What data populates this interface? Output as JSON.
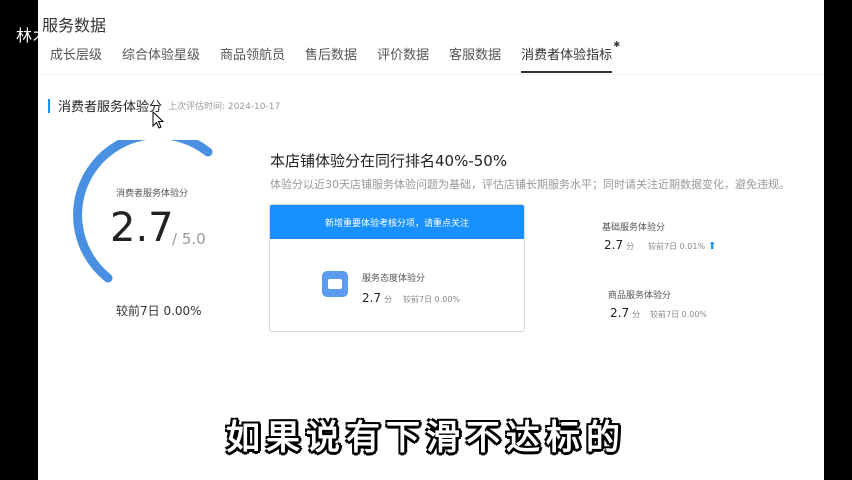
{
  "watermark": "林木",
  "page_title": "服务数据",
  "tabs": [
    {
      "label": "成长层级"
    },
    {
      "label": "综合体验星级"
    },
    {
      "label": "商品领航员"
    },
    {
      "label": "售后数据"
    },
    {
      "label": "评价数据"
    },
    {
      "label": "客服数据"
    },
    {
      "label": "消费者体验指标",
      "active": true
    }
  ],
  "section": {
    "title": "消费者服务体验分",
    "subtitle": "上次评估时间: 2024-10-17"
  },
  "gauge": {
    "label": "消费者服务体验分",
    "score": "2.7",
    "max": "/ 5.0",
    "compare": "较前7日  0.00%",
    "fraction": 0.54,
    "color": "#4a90e2"
  },
  "rank": {
    "title": "本店铺体验分在同行排名40%-50%",
    "desc": "体验分以近30天店铺服务体验问题为基础，评估店铺长期服务水平；同时请关注近期数据变化，避免违规。"
  },
  "card": {
    "banner": "新增重要体验考核分项，请重点关注",
    "item_name": "服务态度体验分",
    "item_score": "2.7",
    "unit": "分",
    "compare": "较前7日  0.00%"
  },
  "side": [
    {
      "name": "基础服务体验分",
      "score": "2.7",
      "unit": "分",
      "compare": "较前7日  0.01%",
      "trend": "up"
    },
    {
      "name": "商品服务体验分",
      "score": "2.7",
      "unit": "分",
      "compare": "较前7日  0.00%"
    }
  ],
  "video_subtitle": "如果说有下滑不达标的",
  "colors": {
    "accent": "#1890ff",
    "gauge": "#4a90e2"
  }
}
